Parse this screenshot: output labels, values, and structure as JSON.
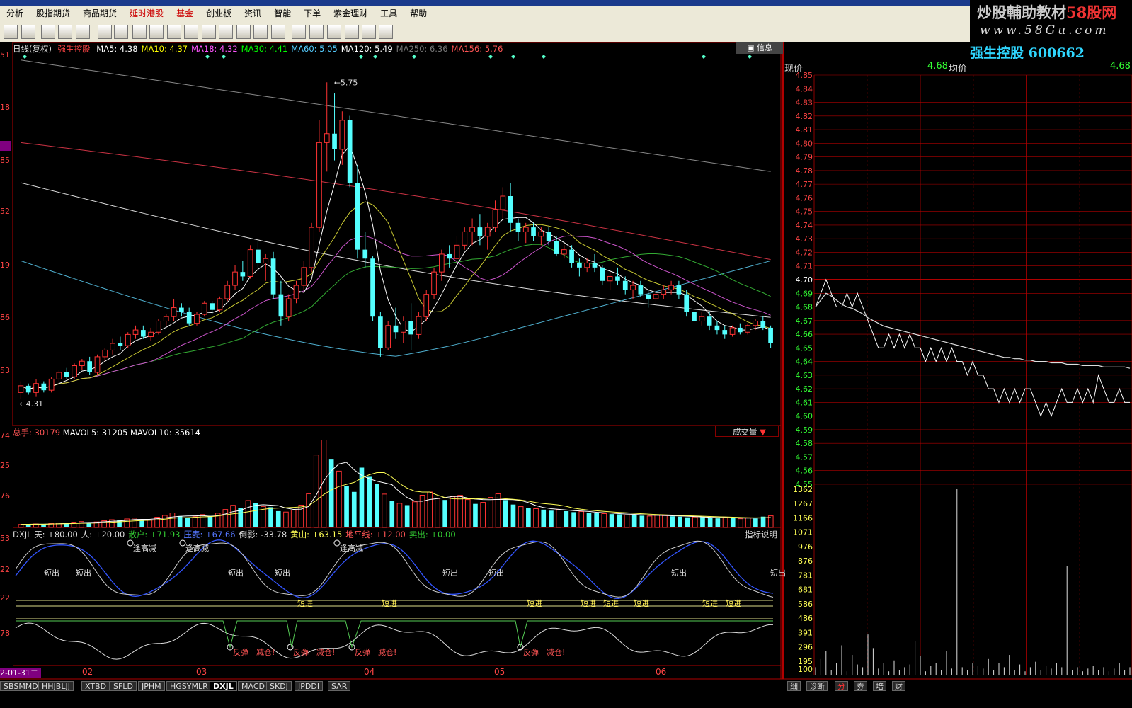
{
  "menu": [
    "分析",
    "股指期货",
    "商品期货",
    "延时港股",
    "基金",
    "创业板",
    "资讯",
    "智能",
    "下单",
    "紫金理财",
    "工具",
    "帮助"
  ],
  "menu_red": [
    "延时港股",
    "基金"
  ],
  "banner": {
    "line1_a": "炒股輔助教材",
    "line1_b": "58股网",
    "line2": "www.58Gu.com"
  },
  "kline_header": {
    "period": "日线(复权)",
    "name": "强生控股",
    "ma": [
      {
        "label": "MA5: 4.38",
        "color": "#ffffff"
      },
      {
        "label": "MA10: 4.37",
        "color": "#ffff00"
      },
      {
        "label": "MA18: 4.32",
        "color": "#ff55ff"
      },
      {
        "label": "MA30: 4.41",
        "color": "#00ff00"
      },
      {
        "label": "MA60: 5.05",
        "color": "#55ccff"
      },
      {
        "label": "MA120: 5.49",
        "color": "#ffffff"
      },
      {
        "label": "MA250: 6.36",
        "color": "#777777"
      },
      {
        "label": "MA156: 5.76",
        "color": "#ff5555"
      }
    ]
  },
  "zx_button": "信息",
  "vol_header": {
    "total": "总手: 30179",
    "mavol5": "MAVOL5: 31205",
    "mavol10": "MAVOL10: 35614",
    "selector": "成交量"
  },
  "dxjl_header": [
    {
      "t": "DXJL 天: +80.00",
      "c": "#dddddd"
    },
    {
      "t": "人: +20.00",
      "c": "#dddddd"
    },
    {
      "t": "散户: +71.93",
      "c": "#33cc33"
    },
    {
      "t": "压麦: +67.66",
      "c": "#5577ff"
    },
    {
      "t": "倒影: -33.78",
      "c": "#dddddd"
    },
    {
      "t": "黄山: +63.15",
      "c": "#ffff55"
    },
    {
      "t": "地平线: +12.00",
      "c": "#ff5555"
    },
    {
      "t": "卖出: +0.00",
      "c": "#33cc33"
    }
  ],
  "indicator_help": "指标说明",
  "stock_title": "强生控股 600662",
  "realtime_header": {
    "label_now": "现价",
    "now": "4.68",
    "label_avg": "均价",
    "avg": "4.68"
  },
  "left_axis_labels": [
    "51",
    "18",
    "94",
    "85",
    "52",
    "19",
    "86",
    "53",
    "74",
    "25",
    "76",
    "53",
    "22",
    "22",
    "78"
  ],
  "bottom_dates": [
    "2-01-31二",
    "02",
    "03",
    "04",
    "05",
    "06"
  ],
  "tabs": [
    "SBSMMD",
    "HHJBLJJ",
    "XTBD",
    "SFLD",
    "JPHM",
    "HGSYMLR",
    "DXJL",
    "MACD",
    "SKDJ",
    "JPDDI",
    "SAR"
  ],
  "active_tab": "DXJL",
  "right_tabs": [
    "细",
    "诊断",
    "分",
    "券",
    "培",
    "财"
  ],
  "active_right_tab": "分",
  "signals": {
    "sell_text": "短出",
    "buy_text": "短进",
    "rebound_text": "反弹",
    "reduce_text": "减仓!",
    "high_reduce_text": "逢高减"
  },
  "chart_data": [
    {
      "type": "candlestick",
      "title": "强生控股 日线(复权)",
      "ylim": [
        4.25,
        5.9
      ],
      "x_months": [
        "02",
        "03",
        "04",
        "05",
        "06"
      ],
      "annotations": [
        {
          "label": "5.75",
          "value": 5.75
        },
        {
          "label": "4.31",
          "value": 4.31
        }
      ],
      "ohlc": [
        [
          4.36,
          4.41,
          4.33,
          4.39
        ],
        [
          4.39,
          4.4,
          4.35,
          4.36
        ],
        [
          4.36,
          4.42,
          4.34,
          4.4
        ],
        [
          4.4,
          4.41,
          4.36,
          4.37
        ],
        [
          4.37,
          4.43,
          4.36,
          4.42
        ],
        [
          4.42,
          4.46,
          4.4,
          4.45
        ],
        [
          4.45,
          4.47,
          4.42,
          4.43
        ],
        [
          4.43,
          4.49,
          4.42,
          4.48
        ],
        [
          4.48,
          4.51,
          4.46,
          4.5
        ],
        [
          4.5,
          4.52,
          4.44,
          4.45
        ],
        [
          4.45,
          4.53,
          4.44,
          4.52
        ],
        [
          4.52,
          4.56,
          4.5,
          4.55
        ],
        [
          4.55,
          4.6,
          4.53,
          4.58
        ],
        [
          4.58,
          4.61,
          4.55,
          4.57
        ],
        [
          4.57,
          4.63,
          4.56,
          4.62
        ],
        [
          4.62,
          4.66,
          4.6,
          4.64
        ],
        [
          4.64,
          4.66,
          4.6,
          4.61
        ],
        [
          4.61,
          4.65,
          4.59,
          4.63
        ],
        [
          4.63,
          4.69,
          4.62,
          4.68
        ],
        [
          4.68,
          4.71,
          4.66,
          4.7
        ],
        [
          4.7,
          4.78,
          4.68,
          4.74
        ],
        [
          4.74,
          4.76,
          4.7,
          4.72
        ],
        [
          4.72,
          4.74,
          4.66,
          4.67
        ],
        [
          4.67,
          4.72,
          4.66,
          4.71
        ],
        [
          4.71,
          4.77,
          4.7,
          4.76
        ],
        [
          4.76,
          4.77,
          4.71,
          4.73
        ],
        [
          4.73,
          4.79,
          4.72,
          4.78
        ],
        [
          4.78,
          4.86,
          4.77,
          4.84
        ],
        [
          4.84,
          4.93,
          4.82,
          4.9
        ],
        [
          4.9,
          4.95,
          4.86,
          4.88
        ],
        [
          4.88,
          5.02,
          4.87,
          5.0
        ],
        [
          5.0,
          5.04,
          4.92,
          4.94
        ],
        [
          4.94,
          4.98,
          4.86,
          4.96
        ],
        [
          4.96,
          4.99,
          4.78,
          4.8
        ],
        [
          4.8,
          4.86,
          4.66,
          4.7
        ],
        [
          4.7,
          4.8,
          4.68,
          4.78
        ],
        [
          4.78,
          4.86,
          4.76,
          4.84
        ],
        [
          4.84,
          4.95,
          4.82,
          4.92
        ],
        [
          4.92,
          5.12,
          4.9,
          5.1
        ],
        [
          5.1,
          5.58,
          5.08,
          5.48
        ],
        [
          5.48,
          5.75,
          5.35,
          5.52
        ],
        [
          5.52,
          5.7,
          5.4,
          5.45
        ],
        [
          5.45,
          5.62,
          5.38,
          5.58
        ],
        [
          5.58,
          5.6,
          5.28,
          5.3
        ],
        [
          5.3,
          5.38,
          4.96,
          5.0
        ],
        [
          5.0,
          5.08,
          4.92,
          4.96
        ],
        [
          4.96,
          4.97,
          4.68,
          4.7
        ],
        [
          4.7,
          4.72,
          4.52,
          4.56
        ],
        [
          4.56,
          4.68,
          4.55,
          4.66
        ],
        [
          4.66,
          4.74,
          4.6,
          4.63
        ],
        [
          4.63,
          4.7,
          4.58,
          4.68
        ],
        [
          4.68,
          4.76,
          4.55,
          4.62
        ],
        [
          4.62,
          4.72,
          4.6,
          4.7
        ],
        [
          4.7,
          4.82,
          4.68,
          4.8
        ],
        [
          4.8,
          4.92,
          4.78,
          4.9
        ],
        [
          4.9,
          5.0,
          4.86,
          4.98
        ],
        [
          4.98,
          5.02,
          4.92,
          4.96
        ],
        [
          4.96,
          5.06,
          4.94,
          5.02
        ],
        [
          5.02,
          5.1,
          5.0,
          5.08
        ],
        [
          5.08,
          5.14,
          5.02,
          5.1
        ],
        [
          5.1,
          5.16,
          5.02,
          5.06
        ],
        [
          5.06,
          5.12,
          5.0,
          5.1
        ],
        [
          5.1,
          5.22,
          5.08,
          5.18
        ],
        [
          5.18,
          5.28,
          5.14,
          5.24
        ],
        [
          5.24,
          5.3,
          5.08,
          5.12
        ],
        [
          5.12,
          5.14,
          5.04,
          5.08
        ],
        [
          5.08,
          5.12,
          5.03,
          5.1
        ],
        [
          5.1,
          5.12,
          5.04,
          5.06
        ],
        [
          5.06,
          5.1,
          5.02,
          5.08
        ],
        [
          5.08,
          5.1,
          5.02,
          5.04
        ],
        [
          5.04,
          5.06,
          4.97,
          4.98
        ],
        [
          4.98,
          5.02,
          4.96,
          5.0
        ],
        [
          5.0,
          5.02,
          4.92,
          4.94
        ],
        [
          4.94,
          4.96,
          4.88,
          4.92
        ],
        [
          4.92,
          4.96,
          4.9,
          4.94
        ],
        [
          4.94,
          4.98,
          4.9,
          4.92
        ],
        [
          4.92,
          4.93,
          4.84,
          4.86
        ],
        [
          4.86,
          4.9,
          4.82,
          4.88
        ],
        [
          4.88,
          4.92,
          4.84,
          4.86
        ],
        [
          4.86,
          4.88,
          4.8,
          4.82
        ],
        [
          4.82,
          4.86,
          4.78,
          4.84
        ],
        [
          4.84,
          4.86,
          4.79,
          4.8
        ],
        [
          4.8,
          4.82,
          4.74,
          4.78
        ],
        [
          4.78,
          4.82,
          4.76,
          4.8
        ],
        [
          4.8,
          4.84,
          4.78,
          4.82
        ],
        [
          4.82,
          4.86,
          4.8,
          4.84
        ],
        [
          4.84,
          4.86,
          4.78,
          4.8
        ],
        [
          4.8,
          4.82,
          4.7,
          4.72
        ],
        [
          4.72,
          4.74,
          4.66,
          4.68
        ],
        [
          4.68,
          4.72,
          4.66,
          4.7
        ],
        [
          4.7,
          4.72,
          4.64,
          4.66
        ],
        [
          4.66,
          4.68,
          4.62,
          4.64
        ],
        [
          4.64,
          4.66,
          4.6,
          4.62
        ],
        [
          4.62,
          4.66,
          4.61,
          4.65
        ],
        [
          4.65,
          4.67,
          4.62,
          4.63
        ],
        [
          4.63,
          4.67,
          4.62,
          4.66
        ],
        [
          4.66,
          4.69,
          4.64,
          4.68
        ],
        [
          4.68,
          4.7,
          4.64,
          4.65
        ],
        [
          4.65,
          4.66,
          4.56,
          4.58
        ]
      ]
    },
    {
      "type": "bar",
      "title": "成交量",
      "ylim": [
        0,
        160000
      ],
      "values": [
        5200,
        5800,
        6100,
        5600,
        7200,
        8000,
        7600,
        9100,
        10200,
        8800,
        9600,
        11800,
        13500,
        12400,
        14800,
        16200,
        14000,
        13200,
        17800,
        21000,
        25200,
        19800,
        16500,
        18600,
        22400,
        20100,
        24800,
        31200,
        38500,
        33600,
        46800,
        42000,
        36500,
        35200,
        28400,
        26800,
        30200,
        38800,
        58600,
        126000,
        152000,
        118000,
        98000,
        72000,
        61800,
        104000,
        88000,
        76000,
        58000,
        46000,
        42000,
        38800,
        44600,
        56000,
        61500,
        50200,
        47800,
        53600,
        55800,
        48500,
        41000,
        43600,
        52200,
        58400,
        47600,
        39800,
        36200,
        33800,
        32600,
        31000,
        29200,
        30800,
        28400,
        26600,
        27800,
        25200,
        24600,
        24000,
        23200,
        22800,
        21600,
        22000,
        20400,
        19800,
        21200,
        20600,
        19400,
        18800,
        17600,
        18200,
        17800,
        16400,
        15800,
        17200,
        16600,
        15200,
        16800,
        15600,
        18800,
        20200
      ]
    },
    {
      "type": "line",
      "title": "分时走势",
      "ylim": [
        4.55,
        4.85
      ],
      "ref_price": 4.7,
      "y_ticks": [
        "4.85",
        "4.84",
        "4.83",
        "4.82",
        "4.81",
        "4.80",
        "4.79",
        "4.78",
        "4.77",
        "4.76",
        "4.75",
        "4.74",
        "4.73",
        "4.72",
        "4.71",
        "4.70",
        "4.69",
        "4.68",
        "4.67",
        "4.66",
        "4.65",
        "4.64",
        "4.63",
        "4.62",
        "4.61",
        "4.60",
        "4.59",
        "4.58",
        "4.57",
        "4.56",
        "4.55"
      ],
      "vol_ticks": [
        "1362",
        "1267",
        "1166",
        "1071",
        "976",
        "876",
        "781",
        "681",
        "586",
        "486",
        "391",
        "296",
        "195",
        "100"
      ],
      "series": [
        {
          "values": [
            4.68,
            4.69,
            4.7,
            4.69,
            4.68,
            4.68,
            4.69,
            4.68,
            4.69,
            4.68,
            4.67,
            4.66,
            4.65,
            4.65,
            4.66,
            4.65,
            4.66,
            4.65,
            4.66,
            4.65,
            4.65,
            4.64,
            4.65,
            4.64,
            4.65,
            4.64,
            4.65,
            4.64,
            4.64,
            4.63,
            4.64,
            4.63,
            4.63,
            4.62,
            4.62,
            4.61,
            4.62,
            4.61,
            4.62,
            4.61,
            4.62,
            4.62,
            4.61,
            4.6,
            4.61,
            4.6,
            4.61,
            4.62,
            4.61,
            4.61,
            4.62,
            4.61,
            4.62,
            4.61,
            4.63,
            4.62,
            4.61,
            4.61,
            4.62,
            4.61,
            4.61
          ]
        },
        {
          "values": [
            4.68,
            4.685,
            4.69,
            4.688,
            4.685,
            4.682,
            4.68,
            4.679,
            4.677,
            4.675,
            4.672,
            4.67,
            4.668,
            4.666,
            4.665,
            4.664,
            4.663,
            4.662,
            4.661,
            4.66,
            4.659,
            4.658,
            4.657,
            4.656,
            4.655,
            4.654,
            4.653,
            4.652,
            4.651,
            4.65,
            4.649,
            4.648,
            4.647,
            4.646,
            4.645,
            4.644,
            4.643,
            4.643,
            4.642,
            4.642,
            4.641,
            4.641,
            4.64,
            4.64,
            4.64,
            4.639,
            4.639,
            4.639,
            4.638,
            4.638,
            4.638,
            4.637,
            4.637,
            4.637,
            4.637,
            4.636,
            4.636,
            4.636,
            4.636,
            4.636,
            4.635
          ]
        }
      ],
      "volume": [
        60,
        120,
        180,
        40,
        90,
        220,
        30,
        150,
        80,
        60,
        300,
        200,
        50,
        90,
        30,
        110,
        40,
        60,
        80,
        250,
        140,
        30,
        70,
        90,
        40,
        180,
        50,
        1362,
        60,
        40,
        90,
        70,
        50,
        120,
        40,
        90,
        60,
        150,
        40,
        80,
        30,
        60,
        100,
        40,
        70,
        50,
        90,
        60,
        800,
        40,
        60,
        30,
        50,
        70,
        40,
        60,
        30,
        50,
        90,
        40,
        60
      ]
    }
  ]
}
